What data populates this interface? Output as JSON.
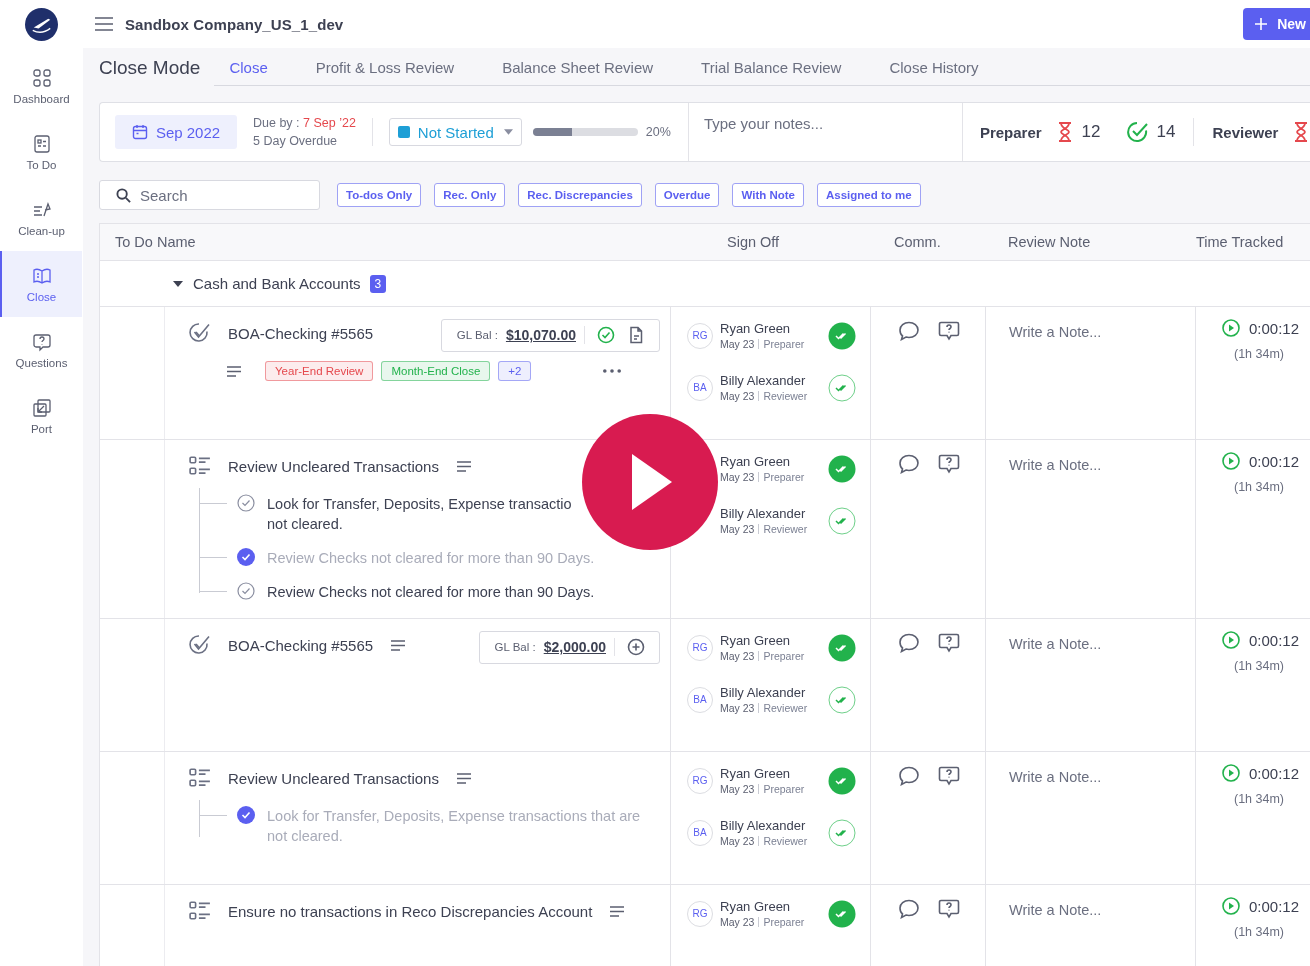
{
  "app": {
    "company": "Sandbox Company_US_1_dev",
    "new_button": "New"
  },
  "sidebar": {
    "items": [
      {
        "label": "Dashboard",
        "selected": false
      },
      {
        "label": "To Do",
        "selected": false
      },
      {
        "label": "Clean-up",
        "selected": false
      },
      {
        "label": "Close",
        "selected": true
      },
      {
        "label": "Questions",
        "selected": false
      },
      {
        "label": "Port",
        "selected": false
      }
    ]
  },
  "page": {
    "title": "Close Mode",
    "tabs": [
      {
        "label": "Close",
        "selected": true
      },
      {
        "label": "Profit & Loss Review",
        "selected": false
      },
      {
        "label": "Balance Sheet Review",
        "selected": false
      },
      {
        "label": "Trial Balance Review",
        "selected": false
      },
      {
        "label": "Close History",
        "selected": false
      }
    ]
  },
  "summary": {
    "period": "Sep 2022",
    "due_label": "Due by :",
    "due_date": "7 Sep ’22",
    "overdue": "5 Day Overdue",
    "status": "Not Started",
    "progress": {
      "level": 0.37,
      "reading": "20%"
    },
    "notes_placeholder": "Type your notes...",
    "preparer": {
      "label": "Preparer",
      "pending": "12",
      "done": "14"
    },
    "reviewer": {
      "label": "Reviewer"
    }
  },
  "filters": {
    "search_placeholder": "Search",
    "chips": [
      "To-dos Only",
      "Rec. Only",
      "Rec. Discrepancies",
      "Overdue",
      "With Note",
      "Assigned to me"
    ]
  },
  "table": {
    "columns": [
      "To Do Name",
      "Sign Off",
      "Comm.",
      "Review Note",
      "Time Tracked"
    ],
    "group": {
      "name": "Cash and Bank Accounts",
      "count": "3",
      "expanded": true
    },
    "rows": [
      {
        "kind": "account",
        "name": "BOA-Checking #5565",
        "gl_label": "GL Bal :",
        "gl_amount": "$10,070.00",
        "reconciled": true,
        "tags": [
          {
            "label": "Year-End Review",
            "color": "#e5484d"
          },
          {
            "label": "Month-End Close",
            "color": "#22b24c"
          },
          {
            "label": "+2",
            "color": "#5b5ff0"
          }
        ],
        "signoffs": [
          {
            "name": "Ryan Green",
            "initials": "RG",
            "date": "May 23",
            "role": "Preparer",
            "signed": true
          },
          {
            "name": "Billy Alexander",
            "initials": "BA",
            "date": "May 23",
            "role": "Reviewer",
            "signed": false
          }
        ],
        "note_placeholder": "Write a Note...",
        "time": "0:00:12",
        "time_total": "(1h 34m)"
      },
      {
        "kind": "checklist",
        "name": "Review Uncleared Transactions",
        "subtasks": [
          {
            "lines": [
              "Look for Transfer, Deposits, Expense transactio",
              "not cleared."
            ],
            "done": false
          },
          {
            "lines": [
              "Review Checks not cleared for more than 90 Days."
            ],
            "done": true
          },
          {
            "lines": [
              "Review Checks not cleared for more than 90 Days."
            ],
            "done": false
          }
        ],
        "signoffs": [
          {
            "name": "Ryan Green",
            "date": "May 23",
            "role": "Preparer",
            "signed": true
          },
          {
            "name": "Billy Alexander",
            "date": "May 23",
            "role": "Reviewer",
            "signed": false
          }
        ],
        "note_placeholder": "Write a Note...",
        "time": "0:00:12",
        "time_total": "(1h 34m)"
      },
      {
        "kind": "account",
        "name": "BOA-Checking #5565",
        "gl_label": "GL Bal :",
        "gl_amount": "$2,000.00",
        "reconciled": false,
        "tags": [],
        "signoffs": [
          {
            "name": "Ryan Green",
            "initials": "RG",
            "date": "May 23",
            "role": "Preparer",
            "signed": true
          },
          {
            "name": "Billy Alexander",
            "initials": "BA",
            "date": "May 23",
            "role": "Reviewer",
            "signed": false
          }
        ],
        "note_placeholder": "Write a Note...",
        "time": "0:00:12",
        "time_total": "(1h 34m)"
      },
      {
        "kind": "checklist",
        "name": "Review Uncleared Transactions",
        "subtasks": [
          {
            "lines": [
              "Look for Transfer, Deposits, Expense transactions that are",
              "not cleared."
            ],
            "done": true
          }
        ],
        "signoffs": [
          {
            "name": "Ryan Green",
            "initials": "RG",
            "date": "May 23",
            "role": "Preparer",
            "signed": true
          },
          {
            "name": "Billy Alexander",
            "initials": "BA",
            "date": "May 23",
            "role": "Reviewer",
            "signed": false
          }
        ],
        "note_placeholder": "Write a Note...",
        "time": "0:00:12",
        "time_total": "(1h 34m)"
      },
      {
        "kind": "checklist",
        "name": "Ensure no transactions in Reco Discrepancies Account",
        "subtasks": [],
        "signoffs": [
          {
            "name": "Ryan Green",
            "initials": "RG",
            "date": "May 23",
            "role": "Preparer",
            "signed": true
          }
        ],
        "note_placeholder": "Write a Note...",
        "time": "0:00:12",
        "time_total": "(1h 34m)"
      }
    ]
  },
  "play_overlay": true
}
